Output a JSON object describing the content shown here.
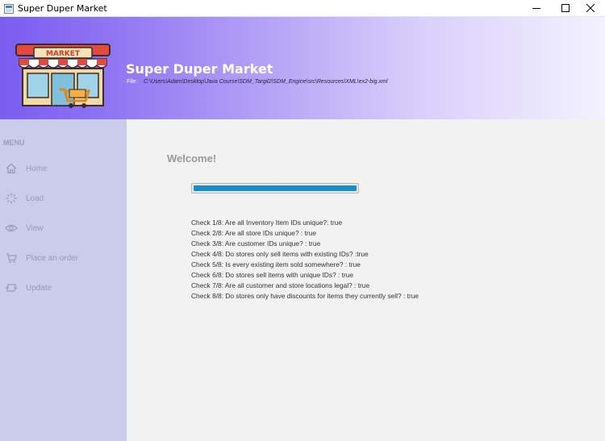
{
  "window": {
    "title": "Super Duper Market"
  },
  "header": {
    "logo_text": "MARKET",
    "app_title": "Super Duper Market",
    "file_label": "File:",
    "file_path": "C:\\Users\\Adam\\Desktop\\Java Course\\SDM_Targil2\\SDM_Engine\\src\\Resources\\XML\\ex2-big.xml"
  },
  "sidebar": {
    "menu_title": "MENU",
    "items": [
      {
        "label": "Home",
        "icon": "home-icon"
      },
      {
        "label": "Load",
        "icon": "loading-icon"
      },
      {
        "label": "View",
        "icon": "eye-icon"
      },
      {
        "label": "Place an order",
        "icon": "cart-icon"
      },
      {
        "label": "Update",
        "icon": "update-icon"
      }
    ]
  },
  "main": {
    "welcome": "Welcome!",
    "progress": 1.0,
    "checks": [
      "Check 1/8: Are all Inventory Item IDs unique?: true",
      "Check 2/8: Are all store IDs unique? : true",
      "Check 3/8: Are customer IDs unique? : true",
      "Check 4/8: Do stores only sell items with existing IDs? :true",
      "Check 5/8: Is every existing item sold somewhere? : true",
      "Check 6/8: Do stores sell items with unique IDs? : true",
      "Check 7/8: Are all customer and store locations legal? : true",
      "Check 8/8: Do stores only have discounts for items they currently sell? : true"
    ]
  },
  "colors": {
    "header_start": "#7a5cf0",
    "sidebar_bg": "#cbcbec",
    "progress_fill": "#1b8ec7"
  }
}
